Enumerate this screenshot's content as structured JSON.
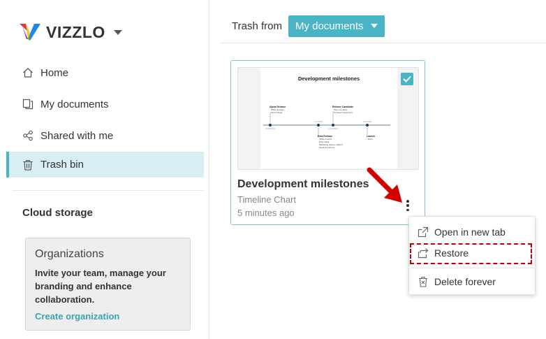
{
  "brand": {
    "name": "VIZZLO"
  },
  "sidebar": {
    "items": [
      {
        "label": "Home",
        "icon": "home-icon"
      },
      {
        "label": "My documents",
        "icon": "documents-icon"
      },
      {
        "label": "Shared with me",
        "icon": "share-icon"
      },
      {
        "label": "Trash bin",
        "icon": "trash-icon",
        "active": true
      }
    ],
    "cloud_storage": "Cloud storage",
    "org_card": {
      "title": "Organizations",
      "text": "Invite your team, manage your branding and enhance collaboration.",
      "link": "Create organization"
    }
  },
  "topbar": {
    "label": "Trash from",
    "select_value": "My documents"
  },
  "card": {
    "title": "Development milestones",
    "type": "Timeline Chart",
    "time": "5 minutes ago",
    "selected": true,
    "thumbnail": {
      "title": "Development milestones",
      "milestones": [
        {
          "title": "Alpha Release",
          "lines": [
            "Office storage",
            "Test funding"
          ]
        },
        {
          "title": "Release Candidate",
          "lines": [
            "Tech complete",
            "UI-travel investment"
          ]
        },
        {
          "title": "Beta Release",
          "lines": [
            "Office moved",
            "Prep today",
            "Marketing actions started",
            "Seed investment"
          ]
        },
        {
          "title": "Launch",
          "lines": [
            "Party"
          ]
        }
      ],
      "axis_labels": [
        "10/25/2020",
        "11/1/2020",
        "11/16/2020",
        "12/4/2020"
      ]
    }
  },
  "context_menu": {
    "items": [
      {
        "label": "Open in new tab",
        "icon": "open-new-tab-icon"
      },
      {
        "label": "Restore",
        "icon": "restore-icon",
        "highlighted": true
      },
      {
        "label": "Delete forever",
        "icon": "delete-icon"
      }
    ]
  },
  "colors": {
    "accent": "#49b4c4",
    "active_bg": "#d9eef2",
    "annotation_red": "#d40000"
  }
}
